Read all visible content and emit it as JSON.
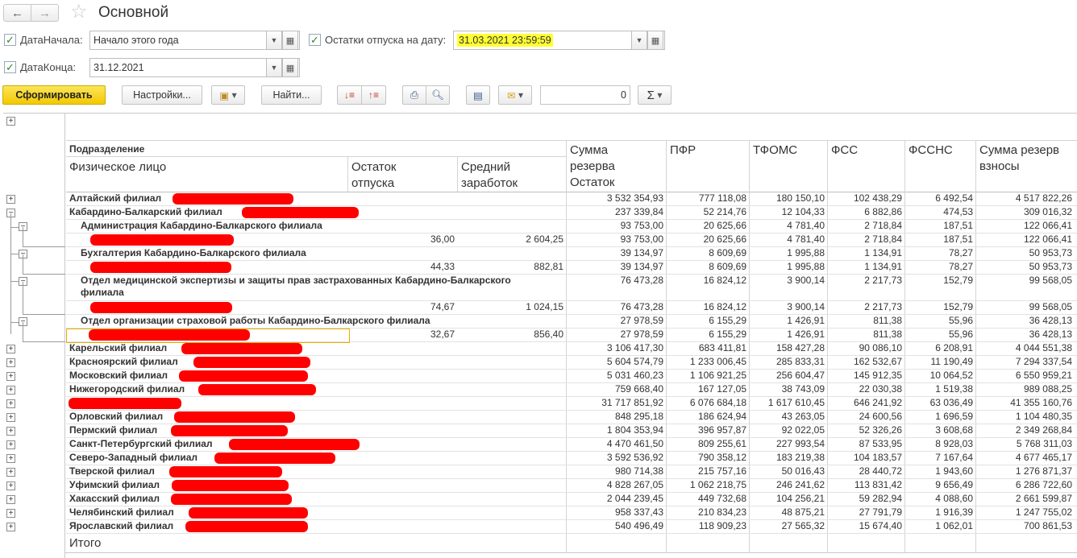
{
  "window": {
    "title": "Основной",
    "nav_back": "←",
    "nav_forward": "→",
    "favorite_icon": "star-icon"
  },
  "params": {
    "start_label": "ДатаНачала:",
    "start_value": "Начало этого года",
    "end_label": "ДатаКонца:",
    "end_value": "31.12.2021",
    "balance_label": "Остатки отпуска на дату:",
    "balance_value": "31.03.2021 23:59:59",
    "highlight_color": "#ffff33"
  },
  "toolbar": {
    "generate": "Сформировать",
    "settings": "Настройки...",
    "find": "Найти...",
    "counter_value": "0",
    "sum_symbol": "Σ",
    "primary_color": "#f3c800"
  },
  "report": {
    "headers": {
      "division": "Подразделение",
      "person": "Физическое лицо",
      "vac_balance": "Остаток отпуска",
      "avg_salary": "Средний заработок",
      "reserve_balance": "Сумма резерва Остаток",
      "pfr": "ПФР",
      "tfoms": "ТФОМС",
      "fss": "ФСС",
      "fssns": "ФССНС",
      "reserve_contrib": "Сумма резерв взносы"
    },
    "total_label": "Итого",
    "rows": [
      {
        "name": "Алтайский филиал",
        "vac": "",
        "avg": "",
        "res": "3 532 354,93",
        "pfr": "777 118,08",
        "tfoms": "180 150,10",
        "fss": "102 438,29",
        "fssns": "6 492,54",
        "contrib": "4 517 822,26"
      },
      {
        "name": "Кабардино-Балкарский филиал",
        "vac": "",
        "avg": "",
        "res": "237 339,84",
        "pfr": "52 214,76",
        "tfoms": "12 104,33",
        "fss": "6 882,86",
        "fssns": "474,53",
        "contrib": "309 016,32"
      },
      {
        "name": "Администрация Кабардино-Балкарского филиала",
        "vac": "",
        "avg": "",
        "res": "93 753,00",
        "pfr": "20 625,66",
        "tfoms": "4 781,40",
        "fss": "2 718,84",
        "fssns": "187,51",
        "contrib": "122 066,41"
      },
      {
        "name": "",
        "vac": "36,00",
        "avg": "2 604,25",
        "res": "93 753,00",
        "pfr": "20 625,66",
        "tfoms": "4 781,40",
        "fss": "2 718,84",
        "fssns": "187,51",
        "contrib": "122 066,41"
      },
      {
        "name": "Бухгалтерия Кабардино-Балкарского филиала",
        "vac": "",
        "avg": "",
        "res": "39 134,97",
        "pfr": "8 609,69",
        "tfoms": "1 995,88",
        "fss": "1 134,91",
        "fssns": "78,27",
        "contrib": "50 953,73"
      },
      {
        "name": "",
        "vac": "44,33",
        "avg": "882,81",
        "res": "39 134,97",
        "pfr": "8 609,69",
        "tfoms": "1 995,88",
        "fss": "1 134,91",
        "fssns": "78,27",
        "contrib": "50 953,73"
      },
      {
        "name": "Отдел медицинской экспертизы и защиты прав застрахованных Кабардино-Балкарского",
        "name2": "филиала",
        "vac": "",
        "avg": "",
        "res": "76 473,28",
        "pfr": "16 824,12",
        "tfoms": "3 900,14",
        "fss": "2 217,73",
        "fssns": "152,79",
        "contrib": "99 568,05"
      },
      {
        "name": "",
        "vac": "74,67",
        "avg": "1 024,15",
        "res": "76 473,28",
        "pfr": "16 824,12",
        "tfoms": "3 900,14",
        "fss": "2 217,73",
        "fssns": "152,79",
        "contrib": "99 568,05"
      },
      {
        "name": "Отдел организации страховой работы Кабардино-Балкарского филиала",
        "vac": "",
        "avg": "",
        "res": "27 978,59",
        "pfr": "6 155,29",
        "tfoms": "1 426,91",
        "fss": "811,38",
        "fssns": "55,96",
        "contrib": "36 428,13"
      },
      {
        "name": "",
        "vac": "32,67",
        "avg": "856,40",
        "res": "27 978,59",
        "pfr": "6 155,29",
        "tfoms": "1 426,91",
        "fss": "811,38",
        "fssns": "55,96",
        "contrib": "36 428,13"
      },
      {
        "name": "Карельский филиал",
        "vac": "",
        "avg": "",
        "res": "3 106 417,30",
        "pfr": "683 411,81",
        "tfoms": "158 427,28",
        "fss": "90 086,10",
        "fssns": "6 208,91",
        "contrib": "4 044 551,38"
      },
      {
        "name": "Красноярский филиал",
        "vac": "",
        "avg": "",
        "res": "5 604 574,79",
        "pfr": "1 233 006,45",
        "tfoms": "285 833,31",
        "fss": "162 532,67",
        "fssns": "11 190,49",
        "contrib": "7 294 337,54"
      },
      {
        "name": "Московский филиал",
        "vac": "",
        "avg": "",
        "res": "5 031 460,23",
        "pfr": "1 106 921,25",
        "tfoms": "256 604,47",
        "fss": "145 912,35",
        "fssns": "10 064,52",
        "contrib": "6 550 959,21"
      },
      {
        "name": "Нижегородский филиал",
        "vac": "",
        "avg": "",
        "res": "759 668,40",
        "pfr": "167 127,05",
        "tfoms": "38 743,09",
        "fss": "22 030,38",
        "fssns": "1 519,38",
        "contrib": "989 088,25"
      },
      {
        "name": "",
        "vac": "",
        "avg": "",
        "res": "31 717 851,92",
        "pfr": "6 076 684,18",
        "tfoms": "1 617 610,45",
        "fss": "646 241,92",
        "fssns": "63 036,49",
        "contrib": "41 355 160,76"
      },
      {
        "name": "Орловский филиал",
        "vac": "",
        "avg": "",
        "res": "848 295,18",
        "pfr": "186 624,94",
        "tfoms": "43 263,05",
        "fss": "24 600,56",
        "fssns": "1 696,59",
        "contrib": "1 104 480,35"
      },
      {
        "name": "Пермский филиал",
        "vac": "",
        "avg": "",
        "res": "1 804 353,94",
        "pfr": "396 957,87",
        "tfoms": "92 022,05",
        "fss": "52 326,26",
        "fssns": "3 608,68",
        "contrib": "2 349 268,84"
      },
      {
        "name": "Санкт-Петербургский филиал",
        "vac": "",
        "avg": "",
        "res": "4 470 461,50",
        "pfr": "809 255,61",
        "tfoms": "227 993,54",
        "fss": "87 533,95",
        "fssns": "8 928,03",
        "contrib": "5 768 311,03"
      },
      {
        "name": "Северо-Западный филиал",
        "vac": "",
        "avg": "",
        "res": "3 592 536,92",
        "pfr": "790 358,12",
        "tfoms": "183 219,38",
        "fss": "104 183,57",
        "fssns": "7 167,64",
        "contrib": "4 677 465,17"
      },
      {
        "name": "Тверской филиал",
        "vac": "",
        "avg": "",
        "res": "980 714,38",
        "pfr": "215 757,16",
        "tfoms": "50 016,43",
        "fss": "28 440,72",
        "fssns": "1 943,60",
        "contrib": "1 276 871,37"
      },
      {
        "name": "Уфимский филиал",
        "vac": "",
        "avg": "",
        "res": "4 828 267,05",
        "pfr": "1 062 218,75",
        "tfoms": "246 241,62",
        "fss": "113 831,42",
        "fssns": "9 656,49",
        "contrib": "6 286 722,60"
      },
      {
        "name": "Хакасский филиал",
        "vac": "",
        "avg": "",
        "res": "2 044 239,45",
        "pfr": "449 732,68",
        "tfoms": "104 256,21",
        "fss": "59 282,94",
        "fssns": "4 088,60",
        "contrib": "2 661 599,87"
      },
      {
        "name": "Челябинский филиал",
        "vac": "",
        "avg": "",
        "res": "958 337,43",
        "pfr": "210 834,23",
        "tfoms": "48 875,21",
        "fss": "27 791,79",
        "fssns": "1 916,39",
        "contrib": "1 247 755,02"
      },
      {
        "name": "Ярославский филиал",
        "vac": "",
        "avg": "",
        "res": "540 496,49",
        "pfr": "118 909,23",
        "tfoms": "27 565,32",
        "fss": "15 674,40",
        "fssns": "1 062,01",
        "contrib": "700 861,53"
      }
    ]
  }
}
